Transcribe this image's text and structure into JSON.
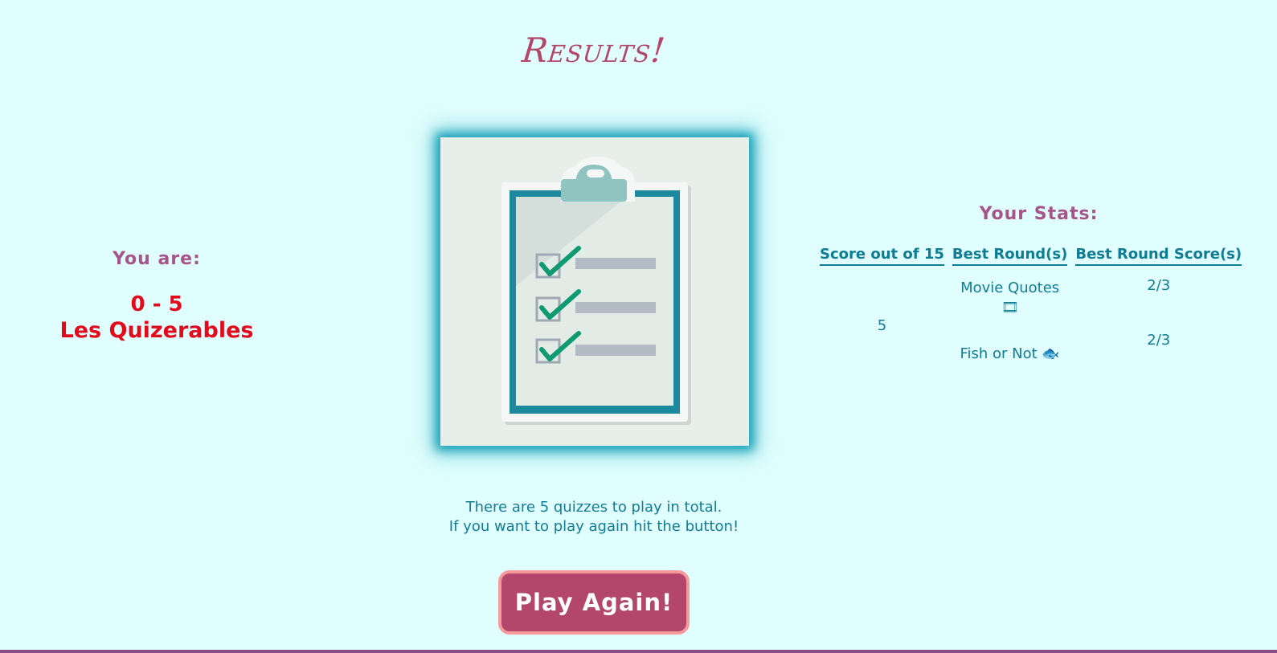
{
  "header": {
    "title": "Results!"
  },
  "result": {
    "you_are_label": "You are:",
    "score_range": "0 - 5",
    "rank_name": "Les Quizerables"
  },
  "image": {
    "alt_icon": "clipboard-checklist-icon"
  },
  "stats": {
    "title": "Your Stats:",
    "columns": [
      "Score out of 15",
      "Best Round(s)",
      "Best Round Score(s)"
    ],
    "score": "5",
    "rounds": [
      {
        "name": "Movie Quotes",
        "icon": "🎞",
        "icon_name": "film-icon",
        "score": "2/3"
      },
      {
        "name": "Fish or Not",
        "icon": "🐟",
        "icon_name": "fish-icon",
        "score": "2/3"
      }
    ]
  },
  "info": {
    "line1": "There are 5 quizzes to play in total.",
    "line2": "If you want to play again hit the button!"
  },
  "actions": {
    "play_again_label": "Play Again!"
  },
  "colors": {
    "background": "#e0fefe",
    "title": "#b2476a",
    "accent_red": "#e20a1b",
    "teal": "#107c93",
    "button": "#b3466b",
    "button_border": "#f79a9b"
  }
}
